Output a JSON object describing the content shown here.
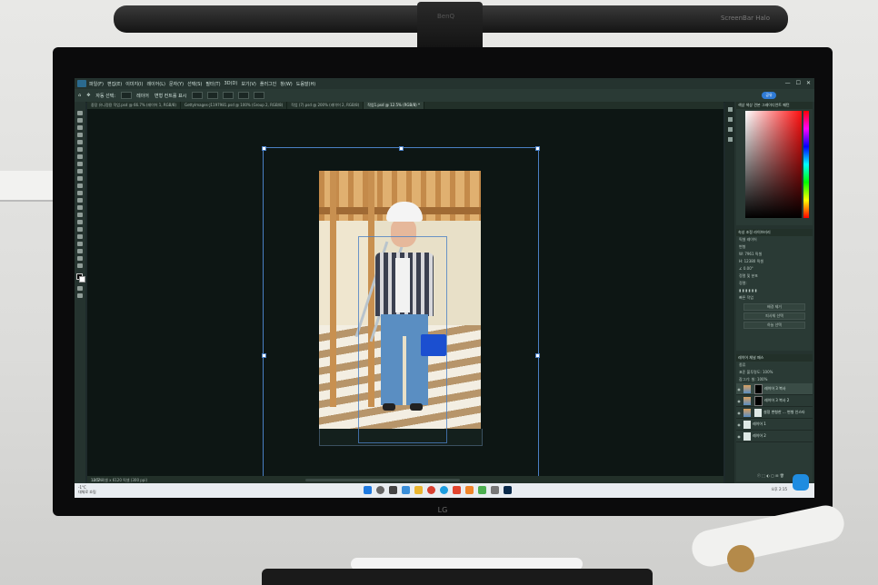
{
  "hardware": {
    "lightbar_label": "ScreenBar Halo",
    "clamp_logo": "BenQ",
    "monitor_logo": "LG"
  },
  "app": {
    "menu": [
      "파일(F)",
      "편집(E)",
      "이미지(I)",
      "레이어(L)",
      "문자(Y)",
      "선택(S)",
      "필터(T)",
      "3D(D)",
      "보기(V)",
      "플러그인",
      "창(W)",
      "도움말(H)"
    ],
    "window_controls": [
      "—",
      "☐",
      "✕"
    ],
    "share_label": "공유"
  },
  "options_bar": {
    "items": [
      "자동 선택:",
      "레이어",
      "변형 컨트롤 표시"
    ]
  },
  "tabs": [
    {
      "label": "중장 유니정용 작업.psd @ 66.7% (레이어 1, RGB/8)",
      "active": false
    },
    {
      "label": "GettyImages-J1197981.psd @ 100% (Group 2, RGB/8)",
      "active": false
    },
    {
      "label": "작업 (7).psd @ 200% (레이어 2, RGB/8)",
      "active": false
    },
    {
      "label": "작업1.psd @ 12.5% (RGB/8) *",
      "active": true
    }
  ],
  "status": {
    "zoom": "12.5%",
    "doc_info": "1462 픽셀 x 6120 픽셀 (300 ppi)"
  },
  "panels": {
    "color_tabs": "색상  색상 견본  그레이디언트  패턴",
    "properties_tabs": "속성  조정  라이브러리",
    "properties_title": "픽셀 레이어",
    "transform_label": "변형",
    "transform_w": "W: 7961 픽셀",
    "transform_h": "H: 12380 픽셀",
    "transform_angle": "∠ 0.00°",
    "align_label": "정렬 및 분포",
    "align_sub": "정렬:",
    "quick_actions_label": "빠른 작업",
    "quick_actions": [
      "배경 제거",
      "피사체 선택",
      "하늘 선택"
    ],
    "layers_tabs": "레이어  채널  패스",
    "kind_label": "종류",
    "blend_label": "표준",
    "opacity_label": "불투명도: 100%",
    "lock_label": "잠그기:",
    "fill_label": "칠: 100%",
    "layers": [
      {
        "name": "레이어 3 복사",
        "selected": true,
        "thumb": "photo"
      },
      {
        "name": "레이어 3 복사 2",
        "selected": false,
        "thumb": "photo"
      },
      {
        "name": "설정 변형한 ... 변형 인스타",
        "selected": false,
        "thumb": "photo"
      },
      {
        "name": "레이어 1",
        "selected": false,
        "thumb": "white"
      },
      {
        "name": "레이어 2",
        "selected": false,
        "thumb": "white"
      }
    ]
  },
  "taskbar": {
    "weather_line1": "-1°C",
    "weather_line2": "대체로 흐림",
    "tray": "오후 2:15"
  },
  "colors": {
    "canvas": "#0d1614",
    "panel": "#2a3a35",
    "accent": "#2f7bd6",
    "bucket": "#1b4fd0"
  }
}
